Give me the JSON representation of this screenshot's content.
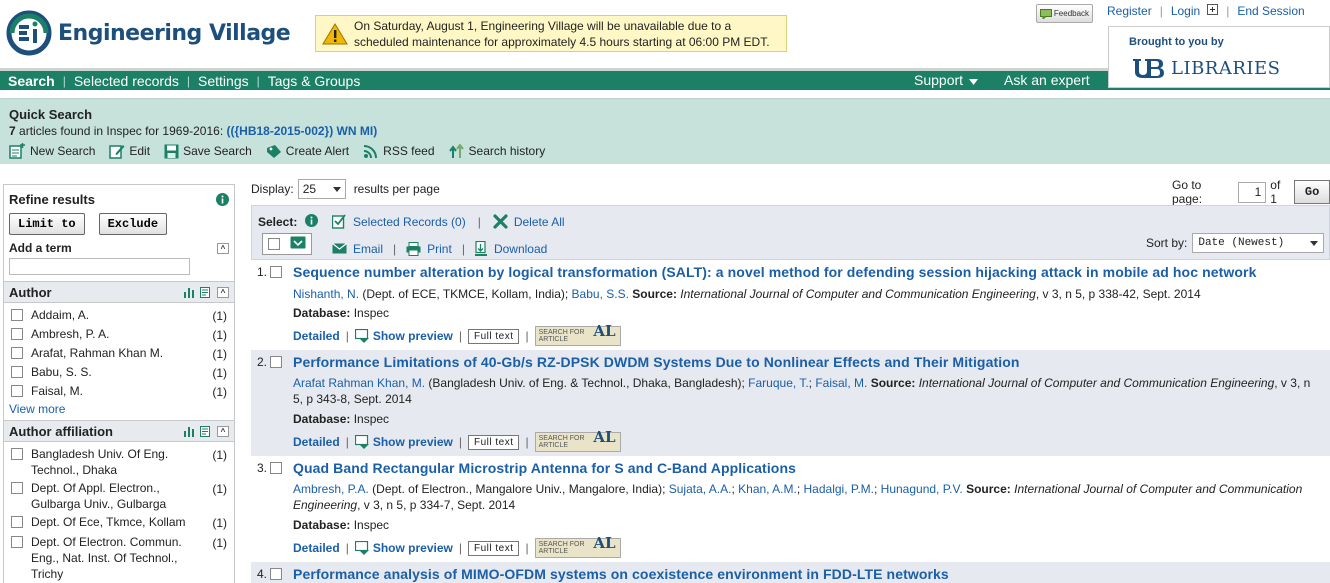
{
  "app": {
    "logo_text": "Engineering Village",
    "maintenance_line1": "On Saturday, August 1, Engineering Village will be unavailable due to a",
    "maintenance_line2": "scheduled maintenance for approximately 4.5 hours starting at 06:00 PM EDT.",
    "feedback_label": "Feedback",
    "register": "Register",
    "login": "Login",
    "end_session": "End Session",
    "brought_to_you": "Brought to you by",
    "libraries": "LIBRARIES",
    "ub_mark": "UB"
  },
  "nav": {
    "search": "Search",
    "selected_records": "Selected records",
    "settings": "Settings",
    "tags_groups": "Tags & Groups",
    "support": "Support",
    "ask_expert": "Ask an expert"
  },
  "quick_search": {
    "title": "Quick Search",
    "count_num": "7",
    "count_text": " articles found in Inspec for 1969-2016: ",
    "query": "(({HB18-2015-002}) WN MI)",
    "tools": {
      "new_search": "New Search",
      "edit": "Edit",
      "save_search": "Save Search",
      "create_alert": "Create Alert",
      "rss_feed": "RSS feed",
      "search_history": "Search history"
    }
  },
  "refine": {
    "title": "Refine results",
    "limit_to": "Limit to",
    "exclude": "Exclude",
    "add_term": "Add a term",
    "author_header": "Author",
    "authors": [
      {
        "name": "Addaim, A.",
        "count": "(1)"
      },
      {
        "name": "Ambresh, P. A.",
        "count": "(1)"
      },
      {
        "name": "Arafat, Rahman Khan M.",
        "count": "(1)"
      },
      {
        "name": "Babu, S. S.",
        "count": "(1)"
      },
      {
        "name": "Faisal, M.",
        "count": "(1)"
      }
    ],
    "view_more": "View more",
    "affiliation_header": "Author affiliation",
    "affiliations": [
      {
        "name": "Bangladesh Univ. Of Eng. Technol., Dhaka",
        "count": "(1)"
      },
      {
        "name": "Dept. Of Appl. Electron., Gulbarga Univ., Gulbarga",
        "count": "(1)"
      },
      {
        "name": "Dept. Of Ece, Tkmce, Kollam",
        "count": "(1)"
      },
      {
        "name": "Dept. Of Electron. Commun. Eng., Nat. Inst. Of Technol., Trichy",
        "count": "(1)"
      }
    ]
  },
  "results_toolbar": {
    "display_label": "Display:",
    "per_page": "25",
    "per_page_suffix": "results per page",
    "goto_label": "Go to page:",
    "page": "1",
    "of_label": "of 1",
    "go": "Go",
    "select_label": "Select:",
    "selected_records": "Selected Records (0)",
    "delete_all": "Delete All",
    "email": "Email",
    "print": "Print",
    "download": "Download",
    "sort_label": "Sort by:",
    "sort_value": "Date (Newest)"
  },
  "result_labels": {
    "database": "Database:",
    "detailed": "Detailed",
    "show_preview": "Show preview",
    "full_text": "Full text",
    "sfa_line1": "SEARCH FOR",
    "sfa_line2": "ARTICLE",
    "sfa_al": "AL",
    "source": "Source:"
  },
  "results": [
    {
      "num": "1.",
      "title": "Sequence number alteration by logical transformation (SALT): a novel method for defending session hijacking attack in mobile ad hoc network",
      "authors": [
        {
          "name": "Nishanth, N.",
          "aff": " (Dept. of ECE, TKMCE, Kollam, India); "
        },
        {
          "name": "Babu, S.S.",
          "aff": " "
        }
      ],
      "source_journal": "International Journal of Computer and Communication Engineering",
      "source_rest": ", v 3, n 5, p 338-42, Sept. 2014",
      "database": "Inspec"
    },
    {
      "num": "2.",
      "title": "Performance Limitations of 40-Gb/s RZ-DPSK DWDM Systems Due to Nonlinear Effects and Their Mitigation",
      "authors": [
        {
          "name": "Arafat Rahman Khan, M.",
          "aff": " (Bangladesh Univ. of Eng. & Technol., Dhaka, Bangladesh); "
        },
        {
          "name": "Faruque, T.",
          "aff": "; "
        },
        {
          "name": "Faisal, M.",
          "aff": " "
        }
      ],
      "source_journal": "International Journal of Computer and Communication Engineering",
      "source_rest": ", v 3, n 5, p 343-8, Sept. 2014",
      "database": "Inspec"
    },
    {
      "num": "3.",
      "title": "Quad Band Rectangular Microstrip Antenna for S and C-Band Applications",
      "authors": [
        {
          "name": "Ambresh, P.A.",
          "aff": " (Dept. of Electron., Mangalore Univ., Mangalore, India); "
        },
        {
          "name": "Sujata, A.A.",
          "aff": "; "
        },
        {
          "name": "Khan, A.M.",
          "aff": "; "
        },
        {
          "name": "Hadalgi, P.M.",
          "aff": "; "
        },
        {
          "name": "Hunagund, P.V.",
          "aff": " "
        }
      ],
      "source_journal": "International Journal of Computer and Communication Engineering",
      "source_rest": ", v 3, n 5, p 334-7, Sept. 2014",
      "database": "Inspec"
    },
    {
      "num": "4.",
      "title": "Performance analysis of MIMO-OFDM systems on coexistence environment in FDD-LTE networks"
    }
  ]
}
